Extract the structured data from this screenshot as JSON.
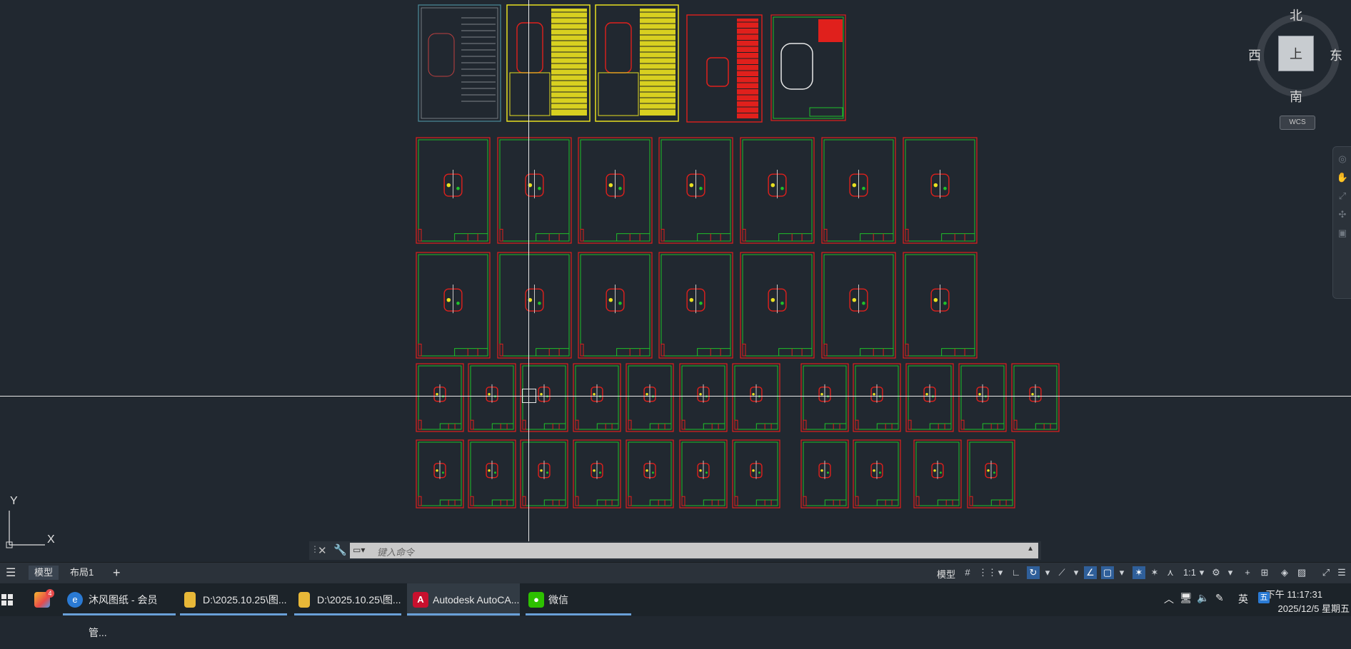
{
  "viewcube": {
    "north": "北",
    "south": "南",
    "east": "东",
    "west": "西",
    "face": "上",
    "wcs": "WCS"
  },
  "ucs": {
    "x_label": "X",
    "y_label": "Y"
  },
  "command_line": {
    "placeholder": "键入命令"
  },
  "layout_tabs": {
    "model": "模型",
    "layout1": "布局1",
    "add": "+"
  },
  "status_bar": {
    "model_label": "模型",
    "scale": "1:1"
  },
  "taskbar": {
    "badge": "4",
    "items": [
      {
        "label": "沐风图纸 - 会员管..."
      },
      {
        "label": "D:\\2025.10.25\\图..."
      },
      {
        "label": "D:\\2025.10.25\\图..."
      },
      {
        "label": "Autodesk AutoCA..."
      },
      {
        "label": "微信"
      }
    ],
    "tray": {
      "ime": "英",
      "time": "下午 11:17:31",
      "date": "2025/12/5 星期五"
    }
  }
}
